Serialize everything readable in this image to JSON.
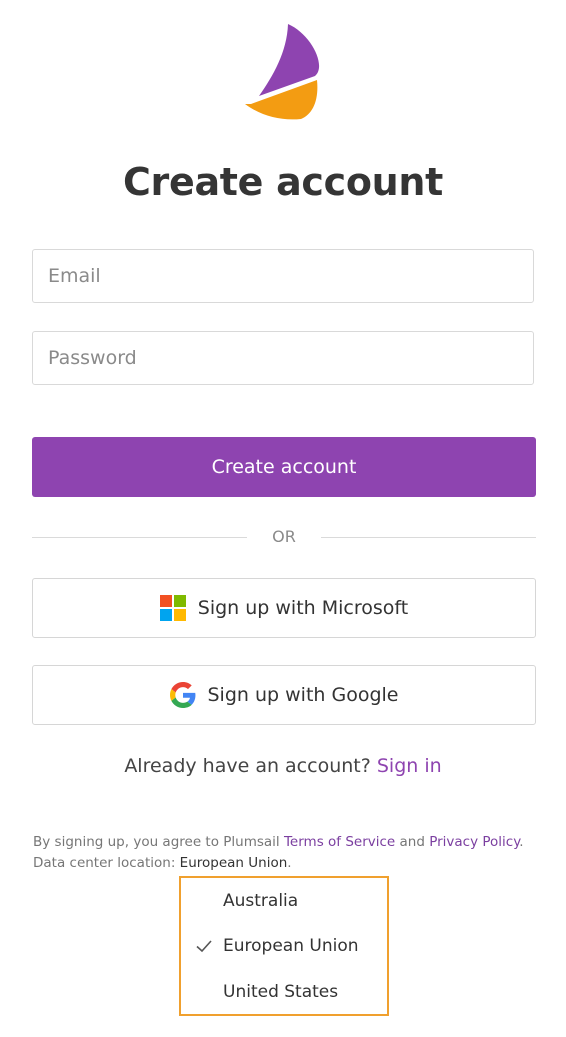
{
  "form": {
    "title": "Create account",
    "email_placeholder": "Email",
    "password_placeholder": "Password",
    "submit_label": "Create account"
  },
  "divider": {
    "text": "OR"
  },
  "sso": {
    "microsoft_label": "Sign up with Microsoft",
    "google_label": "Sign up with Google"
  },
  "signin": {
    "prompt": "Already have an account?",
    "link": "Sign in"
  },
  "legal": {
    "prefix": "By signing up, you agree to Plumsail",
    "terms": "Terms of Service",
    "and": "and",
    "privacy": "Privacy Policy",
    "period": ".",
    "datacenter_label": "Data center location:",
    "datacenter_value": "European Union",
    "datacenter_period": "."
  },
  "datacenter_menu": {
    "selected": "European Union",
    "options": [
      "Australia",
      "European Union",
      "United States"
    ]
  },
  "colors": {
    "primary": "#8e44b0",
    "logo_purple": "#8e44b0",
    "logo_orange": "#f39c12",
    "focus_outline": "#f0a02e"
  },
  "icons": [
    "plumsail-logo",
    "microsoft-icon",
    "google-icon",
    "check-icon"
  ]
}
